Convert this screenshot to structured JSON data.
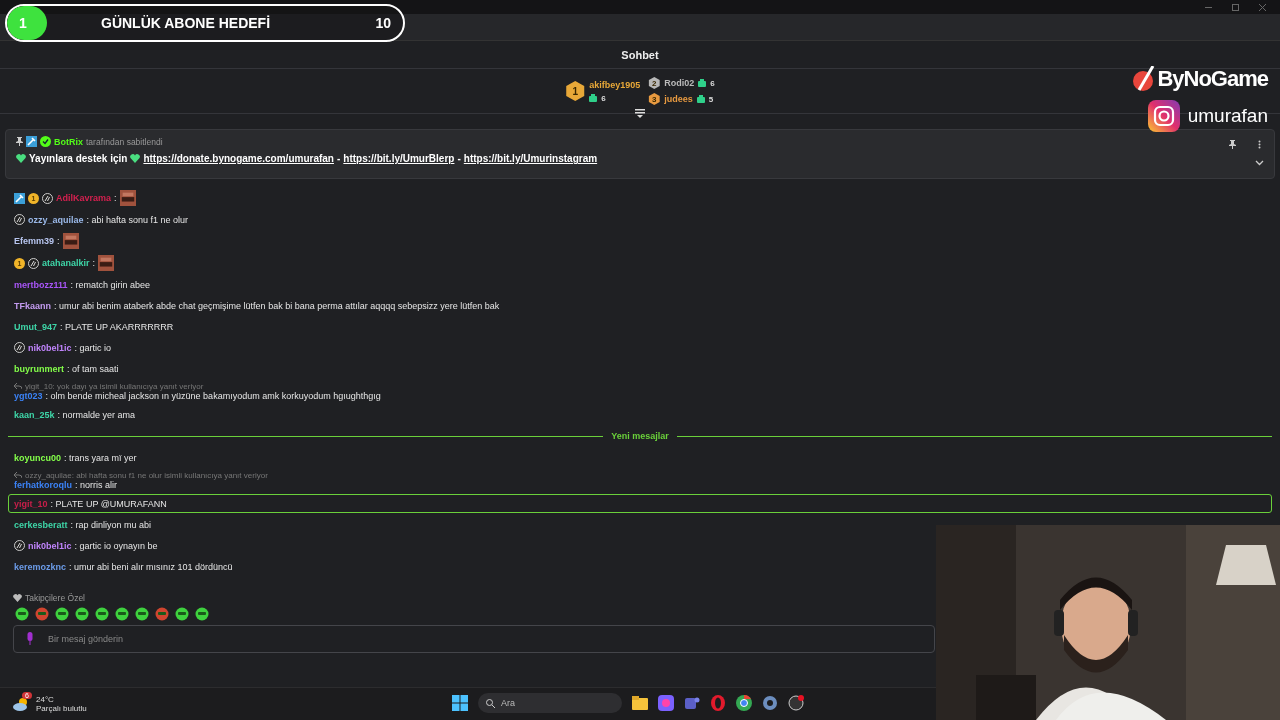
{
  "goal": {
    "count": "1",
    "title": "GÜNLÜK ABONE HEDEFİ",
    "target": "10",
    "level": 0.1
  },
  "chat_header": {
    "title": "Sohbet"
  },
  "leaderboard": [
    {
      "rank": "1",
      "name": "akifbey1905",
      "count": "6",
      "color": "#e8a838"
    },
    {
      "rank": "2",
      "name": "Rodi02",
      "count": "6",
      "color": "#b8b8b8"
    },
    {
      "rank": "3",
      "name": "judees",
      "count": "5",
      "color": "#e89a40"
    }
  ],
  "overlay": {
    "brand": "ByNoGame",
    "instagram": "umurafan"
  },
  "pinned": {
    "pinner": "BotRix",
    "pinned_by": "tarafından sabitlendi",
    "intro": "Yayınlara destek için",
    "links": [
      "https://donate.bynogame.com/umurafan",
      "https://bit.ly/UmurBlerp",
      "https://bit.ly/Umurinstagram"
    ],
    "separator": "-"
  },
  "messages": [
    {
      "kind": "message",
      "badges": [
        {
          "kind": "mod"
        },
        {
          "kind": "sub",
          "label": "1"
        },
        {
          "kind": "og"
        }
      ],
      "user": "AdilKavrama",
      "color": "#d2204f",
      "text": ":",
      "emote": true,
      "highlighted": false
    },
    {
      "kind": "message",
      "badges": [
        {
          "kind": "og"
        }
      ],
      "user": "ozzy_aquilae",
      "color": "#9ab8e8",
      "text": ": abi hafta sonu f1 ne olur",
      "highlighted": false
    },
    {
      "kind": "message",
      "user": "Efemm39",
      "color": "#b8c6f0",
      "text": ":",
      "emote": true,
      "highlighted": false
    },
    {
      "kind": "message",
      "badges": [
        {
          "kind": "sub",
          "label": "1"
        },
        {
          "kind": "og"
        }
      ],
      "user": "atahanalkir",
      "color": "#3ed6a8",
      "text": ":",
      "emote": true,
      "highlighted": false
    },
    {
      "kind": "message",
      "user": "mertbozz111",
      "color": "#a855f7",
      "text": ": rematch girin abee",
      "highlighted": false
    },
    {
      "kind": "message",
      "user": "TFkaann",
      "color": "#c39bf0",
      "text": ": umur abi benim ataberk abde chat geçmişime lütfen bak bi bana perma attılar aqqqq sebepsizz yere lütfen bak",
      "highlighted": false
    },
    {
      "kind": "message",
      "user": "Umut_947",
      "color": "#3ed6a8",
      "text": ": PLATE UP AKARRRRRRR",
      "highlighted": false
    },
    {
      "kind": "message",
      "badges": [
        {
          "kind": "og"
        }
      ],
      "user": "nik0bel1ic",
      "color": "#c084fc",
      "text": ": gartic io",
      "highlighted": false
    },
    {
      "kind": "message",
      "user": "buyrunmert",
      "color": "#84ff4a",
      "text": ": of tam saati",
      "highlighted": false
    },
    {
      "kind": "message",
      "reply": "yigit_10: yok dayı ya isimli kullanıcıya yanıt veriyor",
      "user": "ygt023",
      "color": "#3b82f6",
      "text": ": olm bende micheal jackson ın yüzüne bakamıyodum amk korkuyodum hgıughthgıg",
      "highlighted": false
    },
    {
      "kind": "message",
      "user": "kaan_25k",
      "color": "#3ed6a8",
      "text": ": normalde yer ama",
      "highlighted": false
    },
    {
      "kind": "divider",
      "label": "Yeni mesajlar"
    },
    {
      "kind": "message",
      "user": "koyuncu00",
      "color": "#84ff4a",
      "text": ": trans yara mï yer",
      "highlighted": false
    },
    {
      "kind": "message",
      "reply": "ozzy_aquilae: abi hafta sonu f1 ne olur isimli kullanıcıya yanıt veriyor",
      "user": "ferhatkoroqlu",
      "color": "#3b82f6",
      "text": ": norris alir",
      "highlighted": false
    },
    {
      "kind": "message",
      "user": "yigit_10",
      "color": "#c81e4a",
      "text": ": PLATE UP @UMURAFANN",
      "highlighted": true
    },
    {
      "kind": "message",
      "user": "cerkesberatt",
      "color": "#3ed6a8",
      "text": ": rap dinliyon mu abi",
      "highlighted": false
    },
    {
      "kind": "message",
      "badges": [
        {
          "kind": "og"
        }
      ],
      "user": "nik0bel1ic",
      "color": "#c084fc",
      "text": ": gartic io oynayın be",
      "highlighted": false
    },
    {
      "kind": "message",
      "user": "keremozknc",
      "color": "#6b9be8",
      "text": ": umur abi beni alır mısınız 101 dördüncü",
      "highlighted": false
    }
  ],
  "emote_section": {
    "title": "Takipçilere Özel",
    "emotes": [
      {
        "color": "#3ed13e"
      },
      {
        "color": "#d0452f"
      },
      {
        "color": "#3ed13e"
      },
      {
        "color": "#3ed13e"
      },
      {
        "color": "#3ed13e"
      },
      {
        "color": "#3ed13e"
      },
      {
        "color": "#3ed13e"
      },
      {
        "color": "#d0452f"
      },
      {
        "color": "#3ed13e"
      },
      {
        "color": "#3ed13e"
      }
    ]
  },
  "input": {
    "placeholder": "Bir mesaj gönderin"
  },
  "taskbar": {
    "temperature": "24°C",
    "weather": "Parçalı bulutlu",
    "weather_badge": "6",
    "search_placeholder": "Ara"
  }
}
